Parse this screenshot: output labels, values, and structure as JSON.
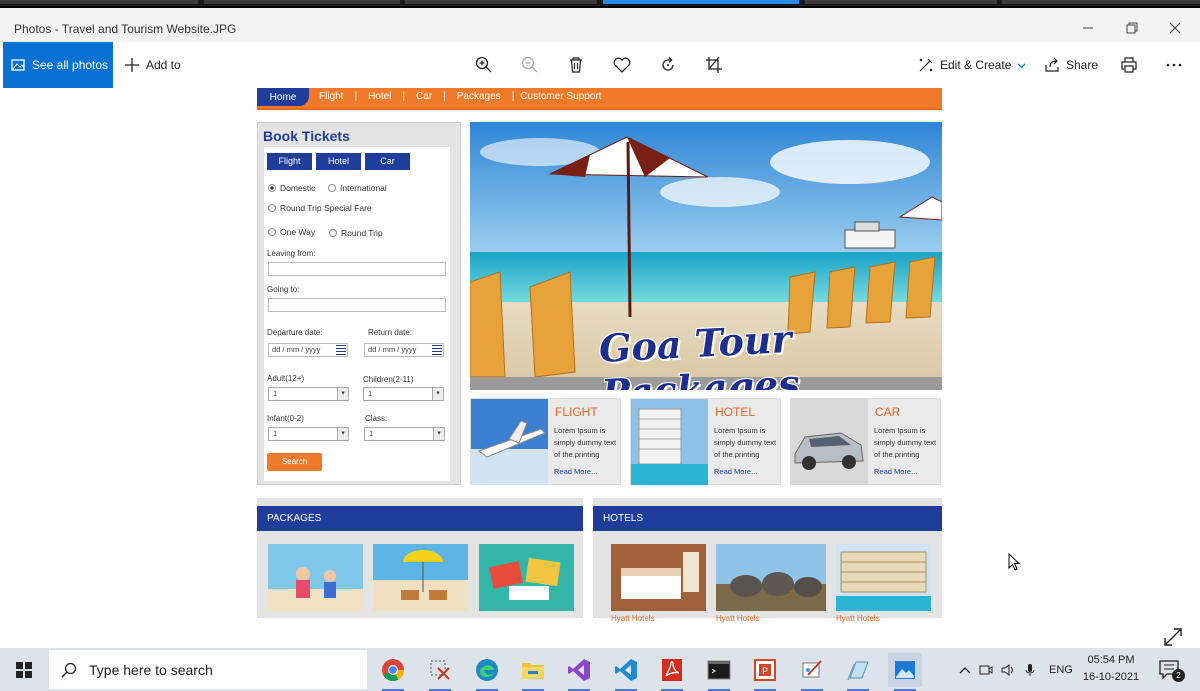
{
  "window": {
    "title": "Photos - Travel and Tourism Website.JPG",
    "controls": [
      "minimize",
      "restore",
      "close"
    ]
  },
  "toolbar": {
    "see_all": "See all photos",
    "add_to": "Add to",
    "edit_create": "Edit & Create",
    "share": "Share",
    "icons": [
      "zoom-in-icon",
      "zoom-out-icon",
      "delete-icon",
      "favorite-icon",
      "rotate-icon",
      "crop-icon",
      "print-icon",
      "more-icon"
    ]
  },
  "site": {
    "nav": {
      "home": "Home",
      "links": [
        "Flight",
        "Hotel",
        "Car",
        "Packages",
        "Customer Support"
      ],
      "separator": "|"
    },
    "book": {
      "title": "Book Tickets",
      "tabs": [
        "Flight",
        "Hotel",
        "Car"
      ],
      "domestic": "Domestic",
      "international": "International",
      "round_trip_special": "Round Trip Special Fare",
      "one_way": "One Way",
      "round_trip": "Round Trip",
      "leaving_from": "Leaving from:",
      "going_to": "Going to:",
      "departure_date": "Departure date:",
      "return_date": "Return date:",
      "date_placeholder": "dd / mm / yyyy",
      "adult": "Adult(12+)",
      "children": "Children(2-11)",
      "infant": "Infant(0-2)",
      "class": "Class:",
      "default_value": "1",
      "search": "Search"
    },
    "hero": {
      "caption": "Goa Tour Packages"
    },
    "cards": [
      {
        "title": "FLIGHT",
        "text": "Lorem Ipsum is simply dummy text of the printing",
        "more": "Read More..."
      },
      {
        "title": "HOTEL",
        "text": "Lorem Ipsum is simply dummy text of the printing",
        "more": "Read More..."
      },
      {
        "title": "CAR",
        "text": "Lorem Ipsum is simply dummy text of the printing",
        "more": "Read More..."
      }
    ],
    "packages": {
      "title": "PACKAGES"
    },
    "hotels": {
      "title": "HOTELS",
      "captions": [
        "Hyatt Hotels",
        "Hyatt Hotels",
        "Hyatt Hotels"
      ]
    }
  },
  "taskbar": {
    "search_placeholder": "Type here to search",
    "language": "ENG",
    "time": "05:54 PM",
    "date": "16-10-2021",
    "notifications": "2",
    "apps": [
      "chrome-icon",
      "snipping-tool-icon",
      "edge-icon",
      "file-explorer-icon",
      "visual-studio-icon",
      "vscode-icon",
      "acrobat-icon",
      "terminal-icon",
      "powerpoint-icon",
      "paint-icon",
      "notepad-icon",
      "photos-icon"
    ]
  }
}
